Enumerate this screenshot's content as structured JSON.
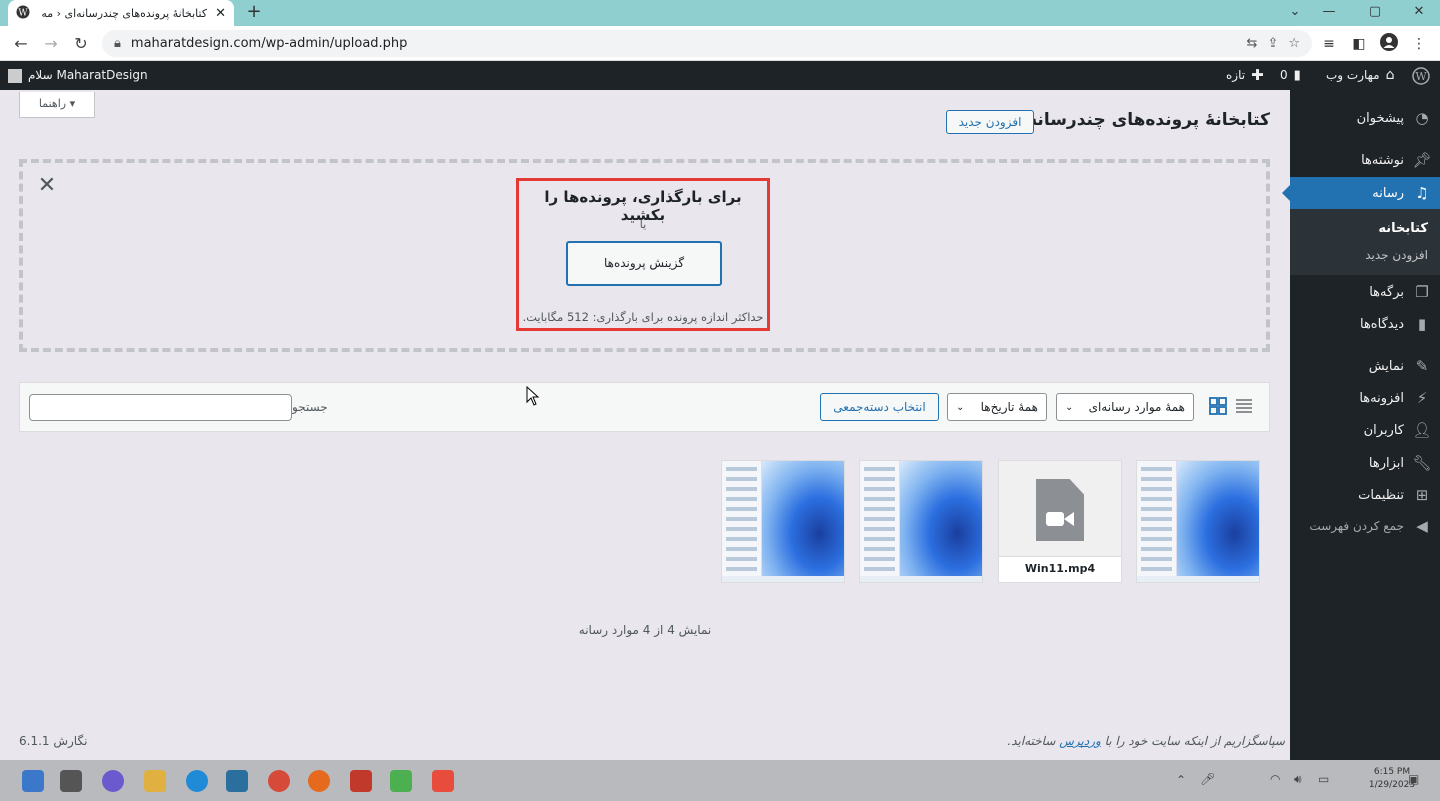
{
  "browser": {
    "tab_title": "کتابخانهٔ پرونده‌های چندرسانه‌ای ‹ مه",
    "url": "maharatdesign.com/wp-admin/upload.php"
  },
  "adminbar": {
    "site_name": "مهارت وب",
    "comments_count": "0",
    "new_label": "تازه",
    "greeting": "سلام MaharatDesign"
  },
  "sidebar": {
    "items": [
      {
        "label": "پیشخوان",
        "icon": "dashboard-icon"
      },
      {
        "label": "نوشته‌ها",
        "icon": "pin-icon"
      },
      {
        "label": "رسانه",
        "icon": "media-icon"
      },
      {
        "label": "برگه‌ها",
        "icon": "pages-icon"
      },
      {
        "label": "دیدگاه‌ها",
        "icon": "comments-icon"
      },
      {
        "label": "نمایش",
        "icon": "appearance-icon"
      },
      {
        "label": "افزونه‌ها",
        "icon": "plugins-icon"
      },
      {
        "label": "کاربران",
        "icon": "users-icon"
      },
      {
        "label": "ابزارها",
        "icon": "tools-icon"
      },
      {
        "label": "تنظیمات",
        "icon": "settings-icon"
      },
      {
        "label": "جمع کردن فهرست",
        "icon": "collapse-icon"
      }
    ],
    "submenu": [
      "کتابخانه",
      "افزودن جدید"
    ]
  },
  "main": {
    "title": "کتابخانهٔ پرونده‌های چندرسانه‌ای",
    "add_new": "افزودن جدید",
    "help": "راهنما",
    "uploader": {
      "drop_title": "برای بارگذاری، پرونده‌ها را بکشید",
      "or": "یا",
      "select_button": "گزینش پرونده‌ها",
      "max_size": "حداکثر اندازه پرونده برای بارگذاری: 512 مگابایت."
    },
    "filters": {
      "media_type": "همهٔ موارد رسانه‌ای",
      "dates": "همهٔ تاریخ‌ها",
      "bulk_select": "انتخاب دسته‌جمعی",
      "search_label": "جستجو",
      "search_value": ""
    },
    "media": [
      {
        "type": "image"
      },
      {
        "type": "video",
        "caption": "Win11.mp4"
      },
      {
        "type": "image"
      },
      {
        "type": "image"
      }
    ],
    "showing": "نمایش 4 از 4 موارد رسانه"
  },
  "footer": {
    "thanks_prefix": "سپاسگزاریم از اینکه سایت خود را با",
    "wordpress_link": "وردپرس",
    "thanks_suffix": "ساخته‌اید.",
    "version": "نگارش 6.1.1"
  },
  "taskbar": {
    "time": "6:15 PM",
    "date": "1/29/2023"
  },
  "colors": {
    "accent": "#2271b1",
    "highlight_box": "#e53935",
    "admin_dark": "#1d2327"
  }
}
